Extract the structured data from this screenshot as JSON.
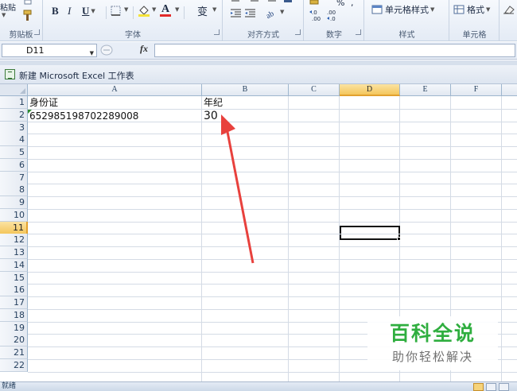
{
  "ribbon": {
    "clipboard": {
      "paste_label": "粘贴",
      "group_label": "剪贴板"
    },
    "font": {
      "bold": "B",
      "italic": "I",
      "underline": "U",
      "font_color": "A",
      "wen": "变",
      "group_label": "字体"
    },
    "alignment": {
      "group_label": "对齐方式"
    },
    "number": {
      "percent": "%",
      "inc_decimal": "←.0\n.00",
      "dec_decimal": ".00\n→.0",
      "group_label": "数字"
    },
    "styles": {
      "cell_styles": "单元格样式",
      "group_label": "样式"
    },
    "cells": {
      "format": "格式",
      "group_label": "单元格"
    }
  },
  "formula_bar": {
    "name_box": "D11",
    "fx": "fx",
    "formula": ""
  },
  "workbook": {
    "title": "新建 Microsoft Excel 工作表"
  },
  "sheet": {
    "columns": [
      "A",
      "B",
      "C",
      "D",
      "E",
      "F"
    ],
    "selected_column": "D",
    "rows": [
      "1",
      "2",
      "3",
      "4",
      "5",
      "6",
      "7",
      "8",
      "9",
      "10",
      "11",
      "12",
      "13",
      "14",
      "15",
      "16",
      "17",
      "18",
      "19",
      "20",
      "21",
      "22"
    ],
    "selected_row": "11",
    "cells": {
      "A1": "身份证",
      "B1": "年纪",
      "A2": "652985198702289008",
      "B2": "30"
    },
    "active_cell": "D11"
  },
  "status_bar": {
    "text": "就绪"
  },
  "watermark": {
    "title": "百科全说",
    "subtitle": "助你轻松解决"
  },
  "colors": {
    "annotation_arrow": "#e8413d",
    "selection_header": "#f4c65c",
    "watermark_green": "#2fae3f"
  }
}
